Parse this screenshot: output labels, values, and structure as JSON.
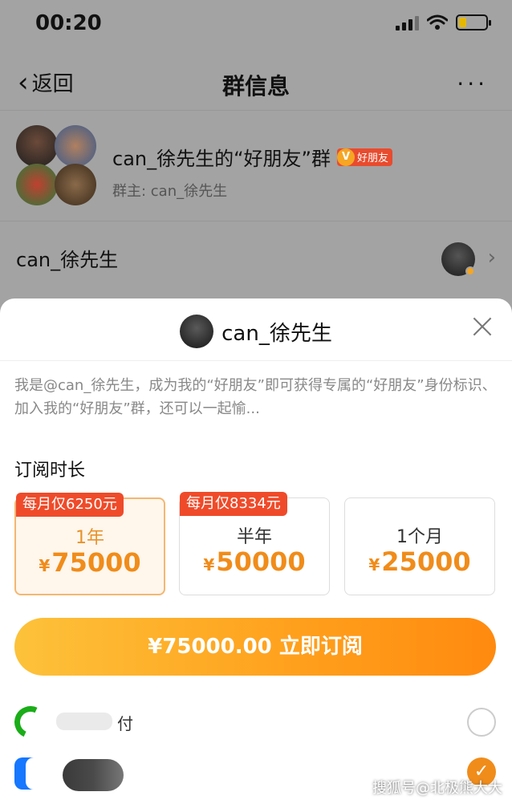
{
  "status_bar": {
    "time": "00:20"
  },
  "nav": {
    "back_label": "返回",
    "title": "群信息",
    "more": "···"
  },
  "group": {
    "name": "can_徐先生的“好朋友”群",
    "badge_text": "好朋友",
    "owner": "群主: can_徐先生"
  },
  "member_row": {
    "name": "can_徐先生",
    "chevron": "›"
  },
  "sheet": {
    "title": "can_徐先生",
    "intro": "我是@can_徐先生，成为我的“好朋友”即可获得专属的“好朋友”身份标识、加入我的“好朋友”群，还可以一起愉...",
    "subscription_label": "订阅时长",
    "plans": [
      {
        "tag": "每月仅6250元",
        "period": "1年",
        "currency": "¥",
        "price": "75000",
        "selected": true
      },
      {
        "tag": "每月仅8334元",
        "period": "半年",
        "currency": "¥",
        "price": "50000",
        "selected": false
      },
      {
        "tag": "",
        "period": "1个月",
        "currency": "¥",
        "price": "25000",
        "selected": false
      }
    ],
    "subscribe_button": "¥75000.00 立即订阅",
    "payment": [
      {
        "label": "付",
        "icon": "wechat-pay-icon",
        "selected": false
      },
      {
        "label": "",
        "icon": "alipay-icon",
        "selected": true
      }
    ],
    "checkmark": "✓"
  },
  "watermark": "搜狐号@北极熊大大",
  "colors": {
    "accent": "#f08c1a",
    "tag_red": "#ef4b2a",
    "wechat_green": "#1aad19"
  }
}
